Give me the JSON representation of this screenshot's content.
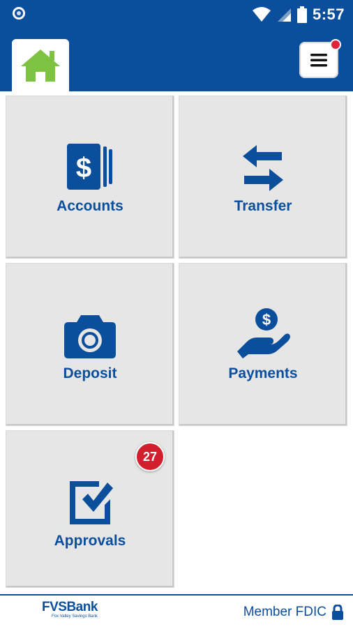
{
  "status_bar": {
    "time": "5:57"
  },
  "header": {
    "home_icon": "home-icon",
    "menu_icon": "hamburger-menu-icon",
    "has_notification": true
  },
  "tiles": [
    {
      "label": "Accounts",
      "icon": "accounts-icon"
    },
    {
      "label": "Transfer",
      "icon": "transfer-arrows-icon"
    },
    {
      "label": "Deposit",
      "icon": "camera-icon"
    },
    {
      "label": "Payments",
      "icon": "hand-coin-icon"
    },
    {
      "label": "Approvals",
      "icon": "checkbox-icon",
      "badge": "27"
    }
  ],
  "footer": {
    "brand": "FVSBank",
    "brand_sub": "Fox Valley Savings Bank",
    "member_text": "Member FDIC"
  },
  "colors": {
    "primary": "#0b4f9c",
    "accent_green": "#7dc242",
    "badge_red": "#d11f2e",
    "tile_bg": "#e6e6e6"
  }
}
